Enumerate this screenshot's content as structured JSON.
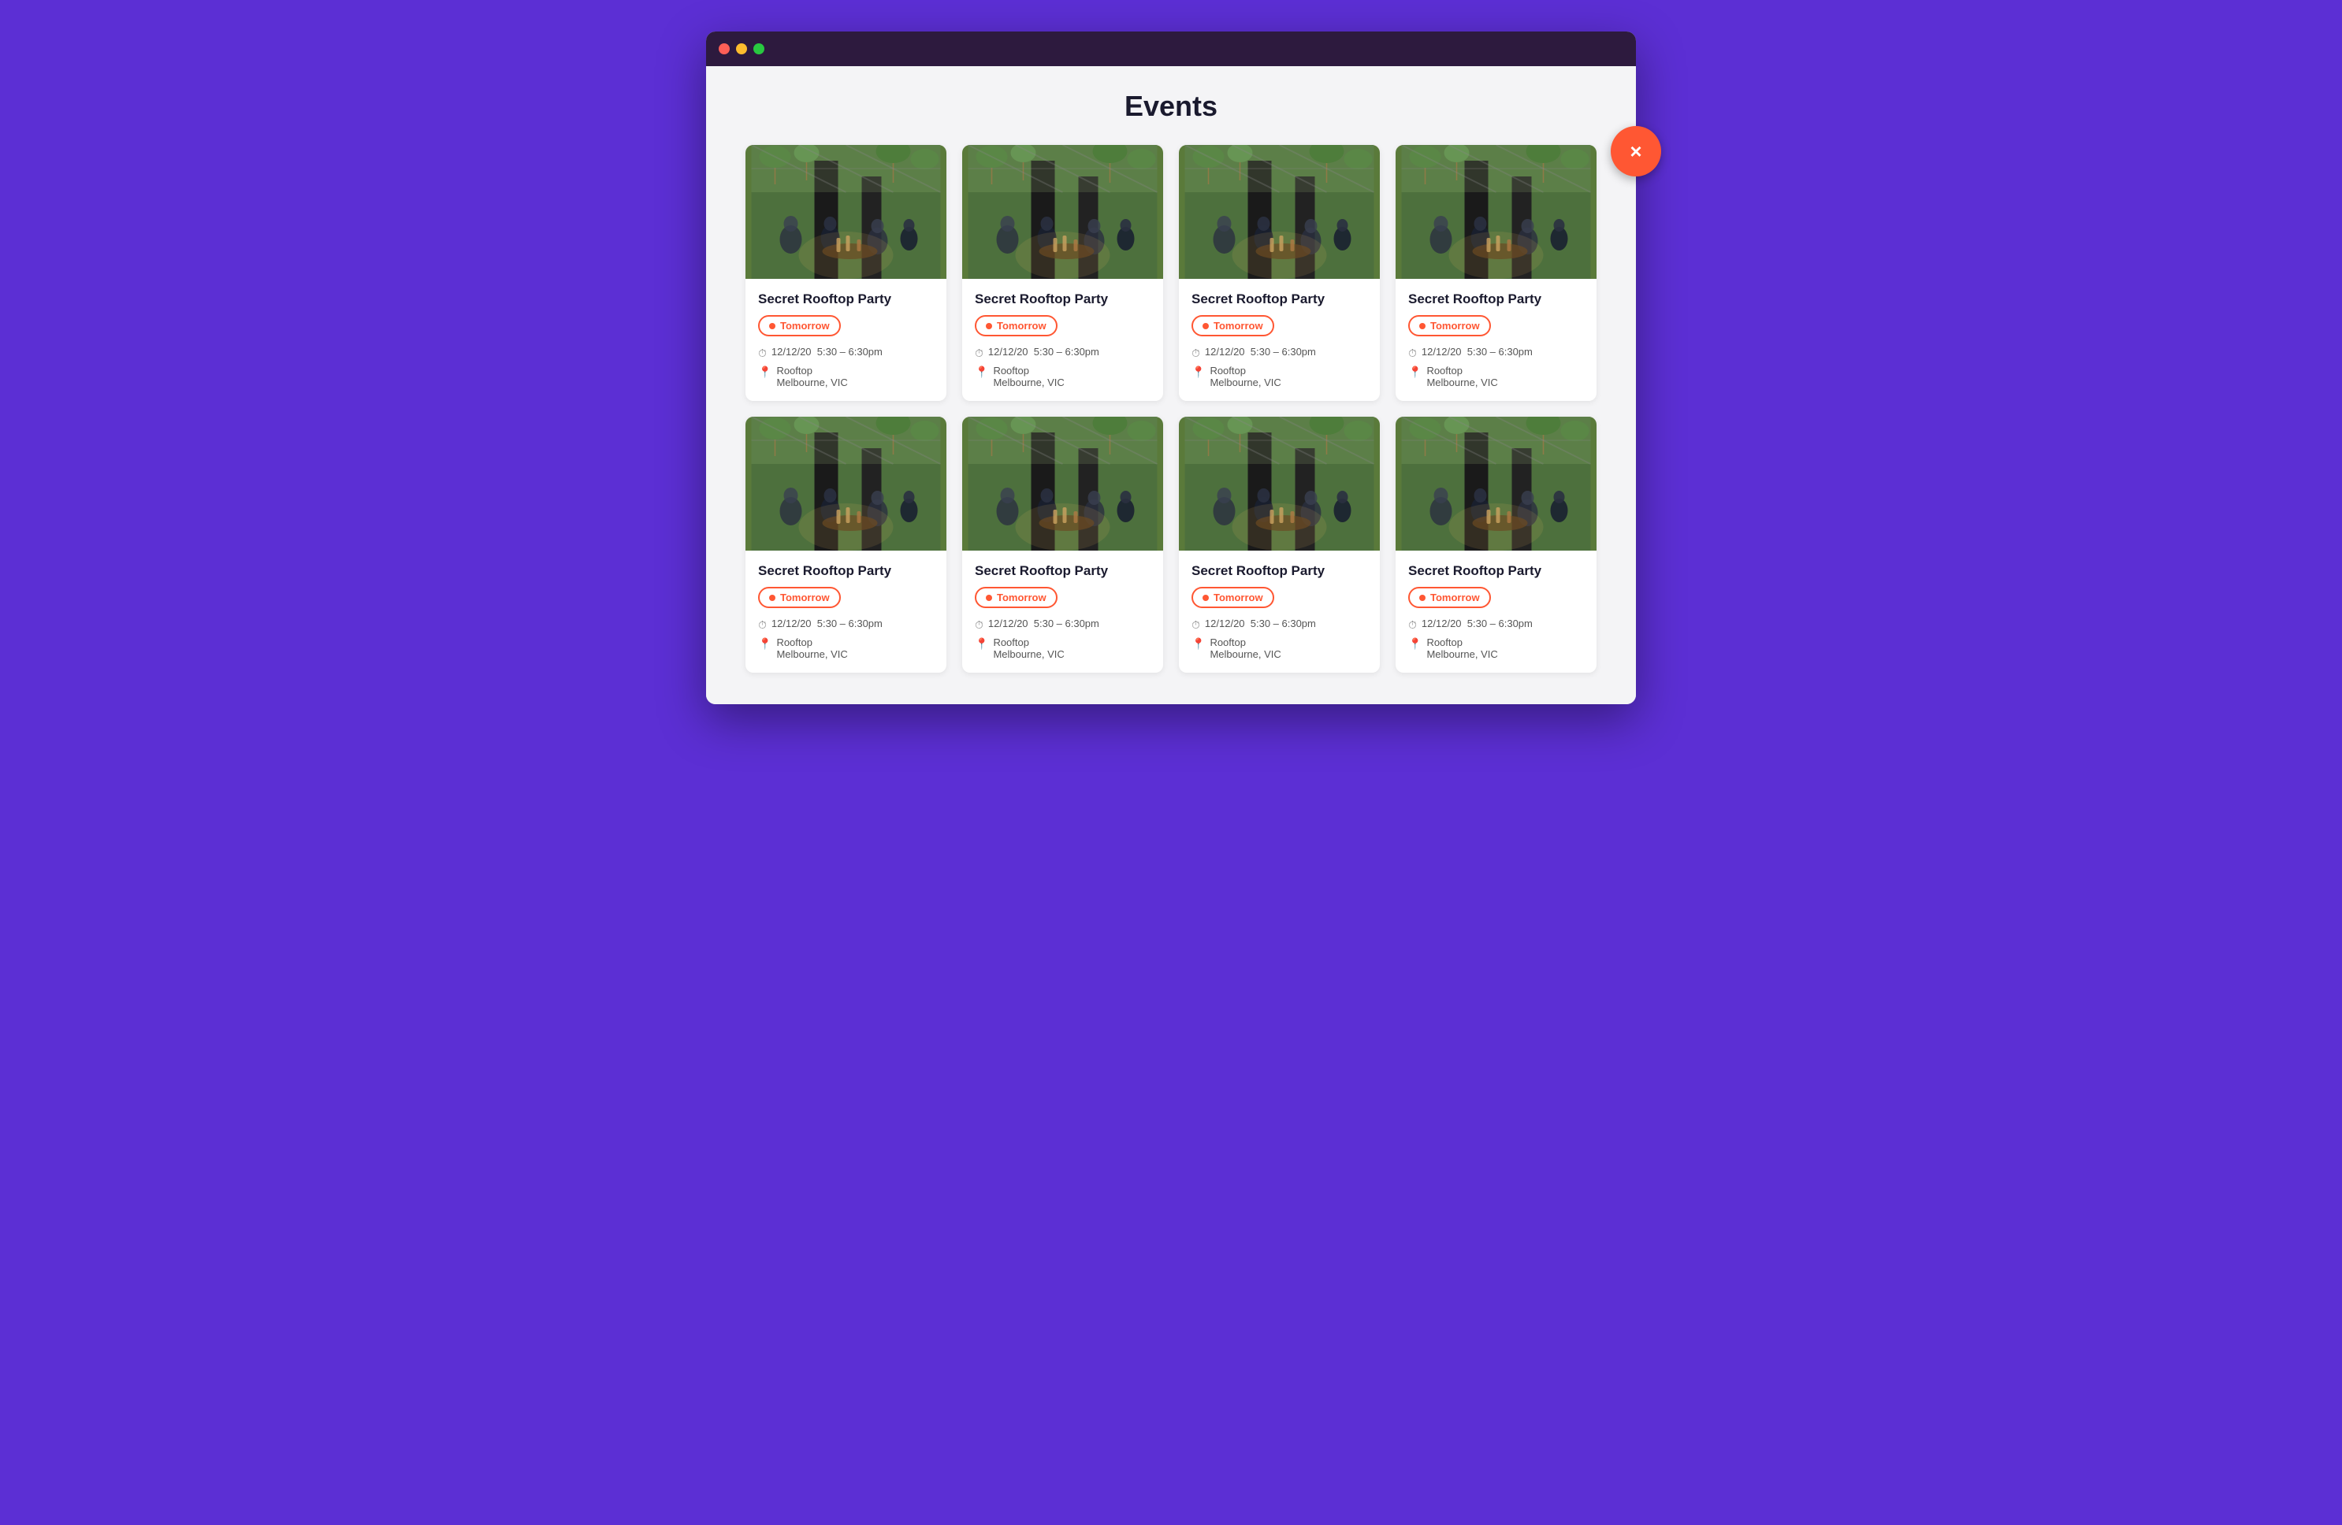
{
  "page": {
    "title": "Events",
    "close_button_label": "×"
  },
  "browser": {
    "traffic_lights": [
      "red",
      "yellow",
      "green"
    ]
  },
  "events": [
    {
      "id": 1,
      "name": "Secret Rooftop Party",
      "badge": "Tomorrow",
      "date": "12/12/20",
      "time": "5:30 – 6:30pm",
      "venue_line1": "Rooftop",
      "venue_line2": "Melbourne, VIC"
    },
    {
      "id": 2,
      "name": "Secret Rooftop Party",
      "badge": "Tomorrow",
      "date": "12/12/20",
      "time": "5:30 – 6:30pm",
      "venue_line1": "Rooftop",
      "venue_line2": "Melbourne, VIC"
    },
    {
      "id": 3,
      "name": "Secret Rooftop Party",
      "badge": "Tomorrow",
      "date": "12/12/20",
      "time": "5:30 – 6:30pm",
      "venue_line1": "Rooftop",
      "venue_line2": "Melbourne, VIC"
    },
    {
      "id": 4,
      "name": "Secret Rooftop Party",
      "badge": "Tomorrow",
      "date": "12/12/20",
      "time": "5:30 – 6:30pm",
      "venue_line1": "Rooftop",
      "venue_line2": "Melbourne, VIC"
    },
    {
      "id": 5,
      "name": "Secret Rooftop Party",
      "badge": "Tomorrow",
      "date": "12/12/20",
      "time": "5:30 – 6:30pm",
      "venue_line1": "Rooftop",
      "venue_line2": "Melbourne, VIC"
    },
    {
      "id": 6,
      "name": "Secret Rooftop Party",
      "badge": "Tomorrow",
      "date": "12/12/20",
      "time": "5:30 – 6:30pm",
      "venue_line1": "Rooftop",
      "venue_line2": "Melbourne, VIC"
    },
    {
      "id": 7,
      "name": "Secret Rooftop Party",
      "badge": "Tomorrow",
      "date": "12/12/20",
      "time": "5:30 – 6:30pm",
      "venue_line1": "Rooftop",
      "venue_line2": "Melbourne, VIC"
    },
    {
      "id": 8,
      "name": "Secret Rooftop Party",
      "badge": "Tomorrow",
      "date": "12/12/20",
      "time": "5:30 – 6:30pm",
      "venue_line1": "Rooftop",
      "venue_line2": "Melbourne, VIC"
    }
  ]
}
